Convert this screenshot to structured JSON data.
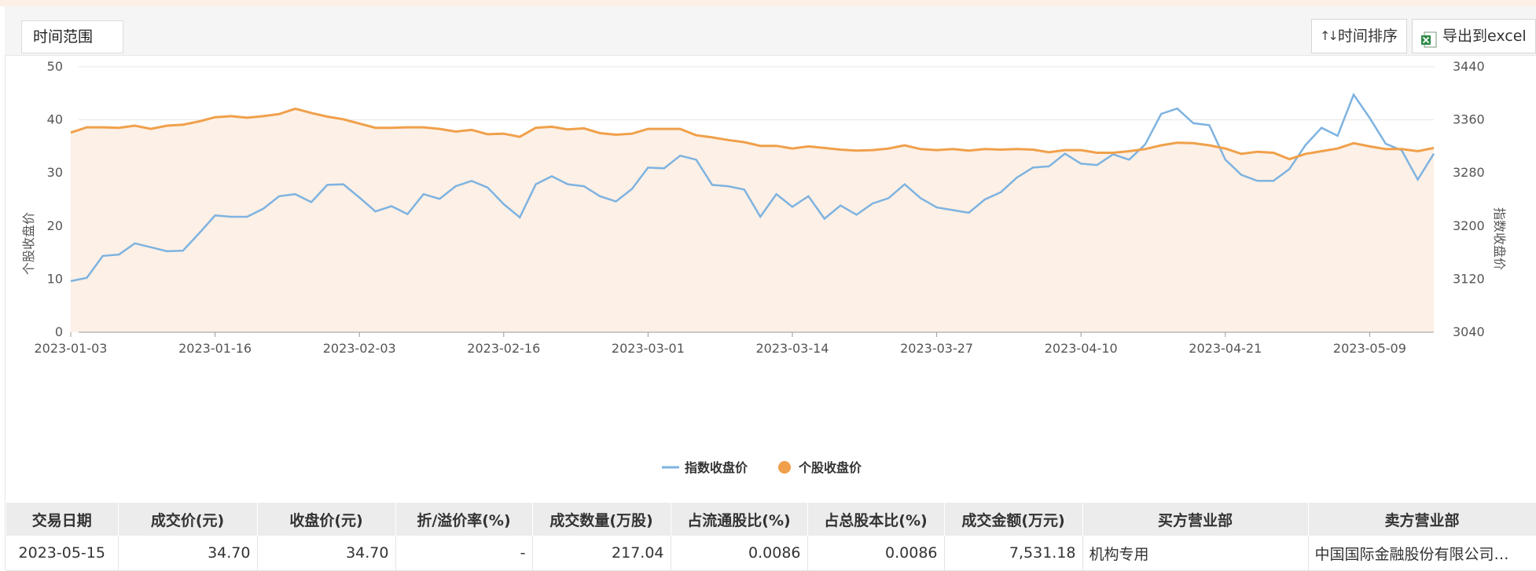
{
  "toolbar": {
    "range_label": "时间范围",
    "sort_label": "时间排序",
    "export_label": "导出到excel",
    "sort_icon": "sort-arrows-icon",
    "export_icon": "excel-icon"
  },
  "chart_data": {
    "type": "line",
    "x": [
      "2023-01-03",
      "2023-01-04",
      "2023-01-05",
      "2023-01-06",
      "2023-01-09",
      "2023-01-10",
      "2023-01-11",
      "2023-01-12",
      "2023-01-13",
      "2023-01-16",
      "2023-01-17",
      "2023-01-18",
      "2023-01-19",
      "2023-01-20",
      "2023-01-30",
      "2023-01-31",
      "2023-02-01",
      "2023-02-02",
      "2023-02-03",
      "2023-02-06",
      "2023-02-07",
      "2023-02-08",
      "2023-02-09",
      "2023-02-10",
      "2023-02-13",
      "2023-02-14",
      "2023-02-15",
      "2023-02-16",
      "2023-02-17",
      "2023-02-20",
      "2023-02-21",
      "2023-02-22",
      "2023-02-23",
      "2023-02-24",
      "2023-02-27",
      "2023-02-28",
      "2023-03-01",
      "2023-03-02",
      "2023-03-03",
      "2023-03-06",
      "2023-03-07",
      "2023-03-08",
      "2023-03-09",
      "2023-03-10",
      "2023-03-13",
      "2023-03-14",
      "2023-03-15",
      "2023-03-16",
      "2023-03-17",
      "2023-03-20",
      "2023-03-21",
      "2023-03-22",
      "2023-03-23",
      "2023-03-24",
      "2023-03-27",
      "2023-03-28",
      "2023-03-29",
      "2023-03-30",
      "2023-03-31",
      "2023-04-03",
      "2023-04-04",
      "2023-04-06",
      "2023-04-07",
      "2023-04-10",
      "2023-04-11",
      "2023-04-12",
      "2023-04-13",
      "2023-04-14",
      "2023-04-17",
      "2023-04-18",
      "2023-04-19",
      "2023-04-20",
      "2023-04-21",
      "2023-04-24",
      "2023-04-25",
      "2023-04-26",
      "2023-04-27",
      "2023-04-28",
      "2023-05-04",
      "2023-05-05",
      "2023-05-08",
      "2023-05-09",
      "2023-05-10",
      "2023-05-11",
      "2023-05-12",
      "2023-05-15"
    ],
    "x_ticks": [
      "2023-01-03",
      "2023-01-16",
      "2023-02-03",
      "2023-02-16",
      "2023-03-01",
      "2023-03-14",
      "2023-03-27",
      "2023-04-10",
      "2023-04-21",
      "2023-05-09"
    ],
    "series": [
      {
        "name": "指数收盘价",
        "axis": "right",
        "color": "#7eb3e0",
        "values": [
          3117,
          3122,
          3155,
          3157,
          3174,
          3168,
          3162,
          3163,
          3189,
          3216,
          3214,
          3214,
          3226,
          3245,
          3248,
          3236,
          3262,
          3263,
          3243,
          3222,
          3230,
          3218,
          3248,
          3241,
          3260,
          3268,
          3258,
          3233,
          3213,
          3263,
          3275,
          3263,
          3260,
          3245,
          3237,
          3256,
          3288,
          3287,
          3306,
          3300,
          3262,
          3260,
          3255,
          3214,
          3248,
          3229,
          3245,
          3211,
          3231,
          3217,
          3234,
          3242,
          3263,
          3242,
          3228,
          3224,
          3220,
          3240,
          3251,
          3273,
          3288,
          3290,
          3309,
          3294,
          3292,
          3308,
          3300,
          3323,
          3369,
          3377,
          3355,
          3352,
          3300,
          3277,
          3268,
          3268,
          3286,
          3322,
          3348,
          3336,
          3398,
          3363,
          3324,
          3314,
          3270,
          3309
        ]
      },
      {
        "name": "个股收盘价",
        "axis": "left",
        "color": "#f0a04b",
        "values": [
          37.6,
          38.6,
          38.6,
          38.5,
          38.9,
          38.3,
          38.9,
          39.1,
          39.7,
          40.5,
          40.7,
          40.4,
          40.7,
          41.1,
          42.1,
          41.3,
          40.6,
          40.1,
          39.3,
          38.5,
          38.5,
          38.6,
          38.6,
          38.3,
          37.8,
          38.1,
          37.3,
          37.4,
          36.8,
          38.5,
          38.7,
          38.2,
          38.4,
          37.5,
          37.2,
          37.4,
          38.3,
          38.3,
          38.3,
          37.1,
          36.7,
          36.2,
          35.8,
          35.1,
          35.1,
          34.6,
          35.0,
          34.7,
          34.4,
          34.2,
          34.3,
          34.6,
          35.2,
          34.5,
          34.3,
          34.5,
          34.2,
          34.5,
          34.4,
          34.5,
          34.4,
          33.9,
          34.3,
          34.3,
          33.8,
          33.8,
          34.1,
          34.5,
          35.2,
          35.7,
          35.6,
          35.2,
          34.6,
          33.6,
          34.0,
          33.8,
          32.6,
          33.6,
          34.1,
          34.6,
          35.6,
          35.0,
          34.5,
          34.5,
          34.1,
          34.7
        ]
      }
    ],
    "y_left": {
      "label": "个股收盘价",
      "ylim": [
        0,
        50
      ],
      "ticks": [
        0,
        10,
        20,
        30,
        40,
        50
      ]
    },
    "y_right": {
      "label": "指数收盘价",
      "ylim": [
        3040,
        3440
      ],
      "ticks": [
        3040,
        3120,
        3200,
        3280,
        3360,
        3440
      ]
    },
    "grid": true,
    "legend": "bottom-center",
    "area_fill_color": "#fdf0e6"
  },
  "table": {
    "headers": [
      "交易日期",
      "成交价(元)",
      "收盘价(元)",
      "折/溢价率(%)",
      "成交数量(万股)",
      "占流通股比(%)",
      "占总股本比(%)",
      "成交金额(万元)",
      "买方营业部",
      "卖方营业部"
    ],
    "rows": [
      [
        "2023-05-15",
        "34.70",
        "34.70",
        "-",
        "217.04",
        "0.0086",
        "0.0086",
        "7,531.18",
        "机构专用",
        "中国国际金融股份有限公司…"
      ]
    ]
  }
}
